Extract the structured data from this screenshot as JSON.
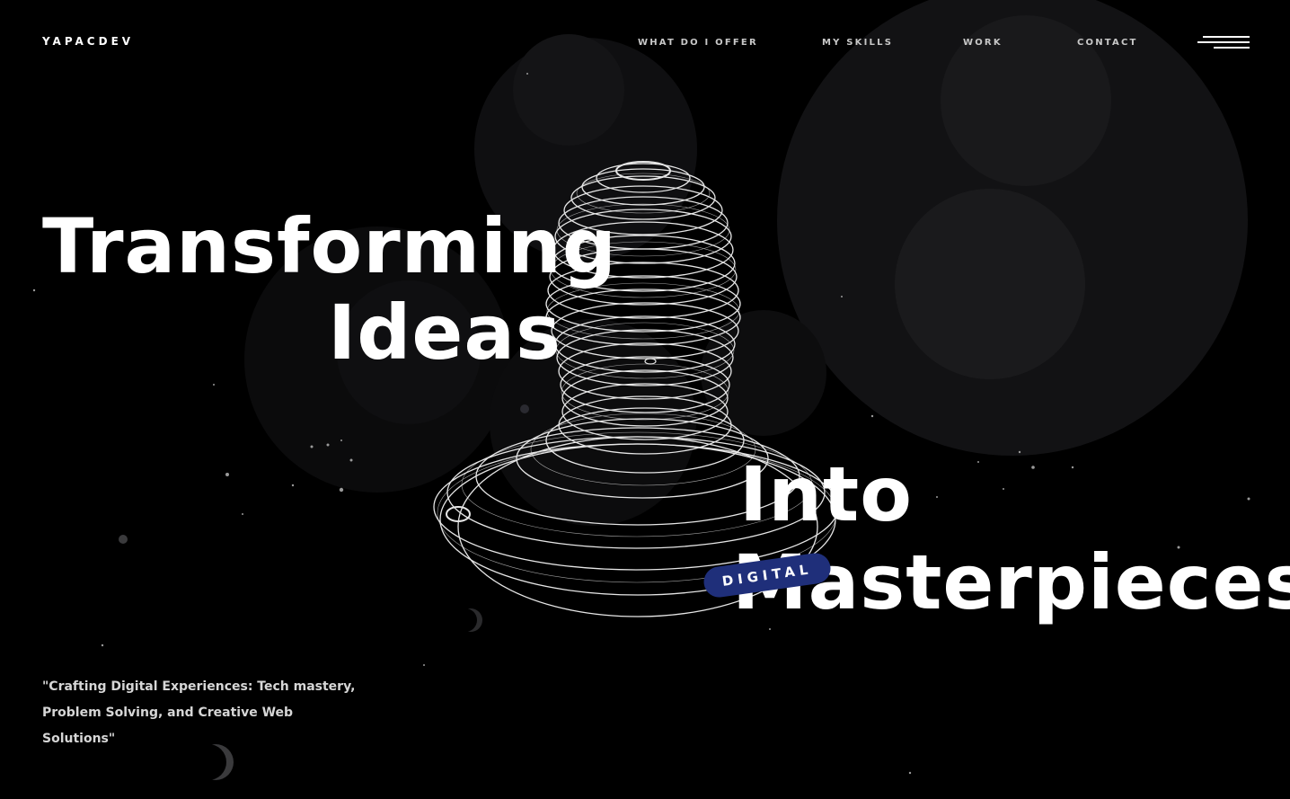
{
  "header": {
    "logo": "YAPACDEV",
    "nav": [
      {
        "label": "WHAT DO I OFFER"
      },
      {
        "label": "MY SKILLS"
      },
      {
        "label": "WORK"
      },
      {
        "label": "CONTACT"
      }
    ],
    "menu_icon": "hamburger-icon"
  },
  "hero": {
    "line1": "Transforming",
    "line2": "Ideas",
    "line3": "Into",
    "line4": "Masterpieces",
    "badge": "DIGITAL",
    "tagline": "\"Crafting Digital Experiences: Tech mastery, Problem Solving, and Creative Web Solutions\""
  },
  "colors": {
    "background": "#000000",
    "text": "#ffffff",
    "nav_text": "#c8c8c8",
    "badge": "#1f2f7a"
  }
}
